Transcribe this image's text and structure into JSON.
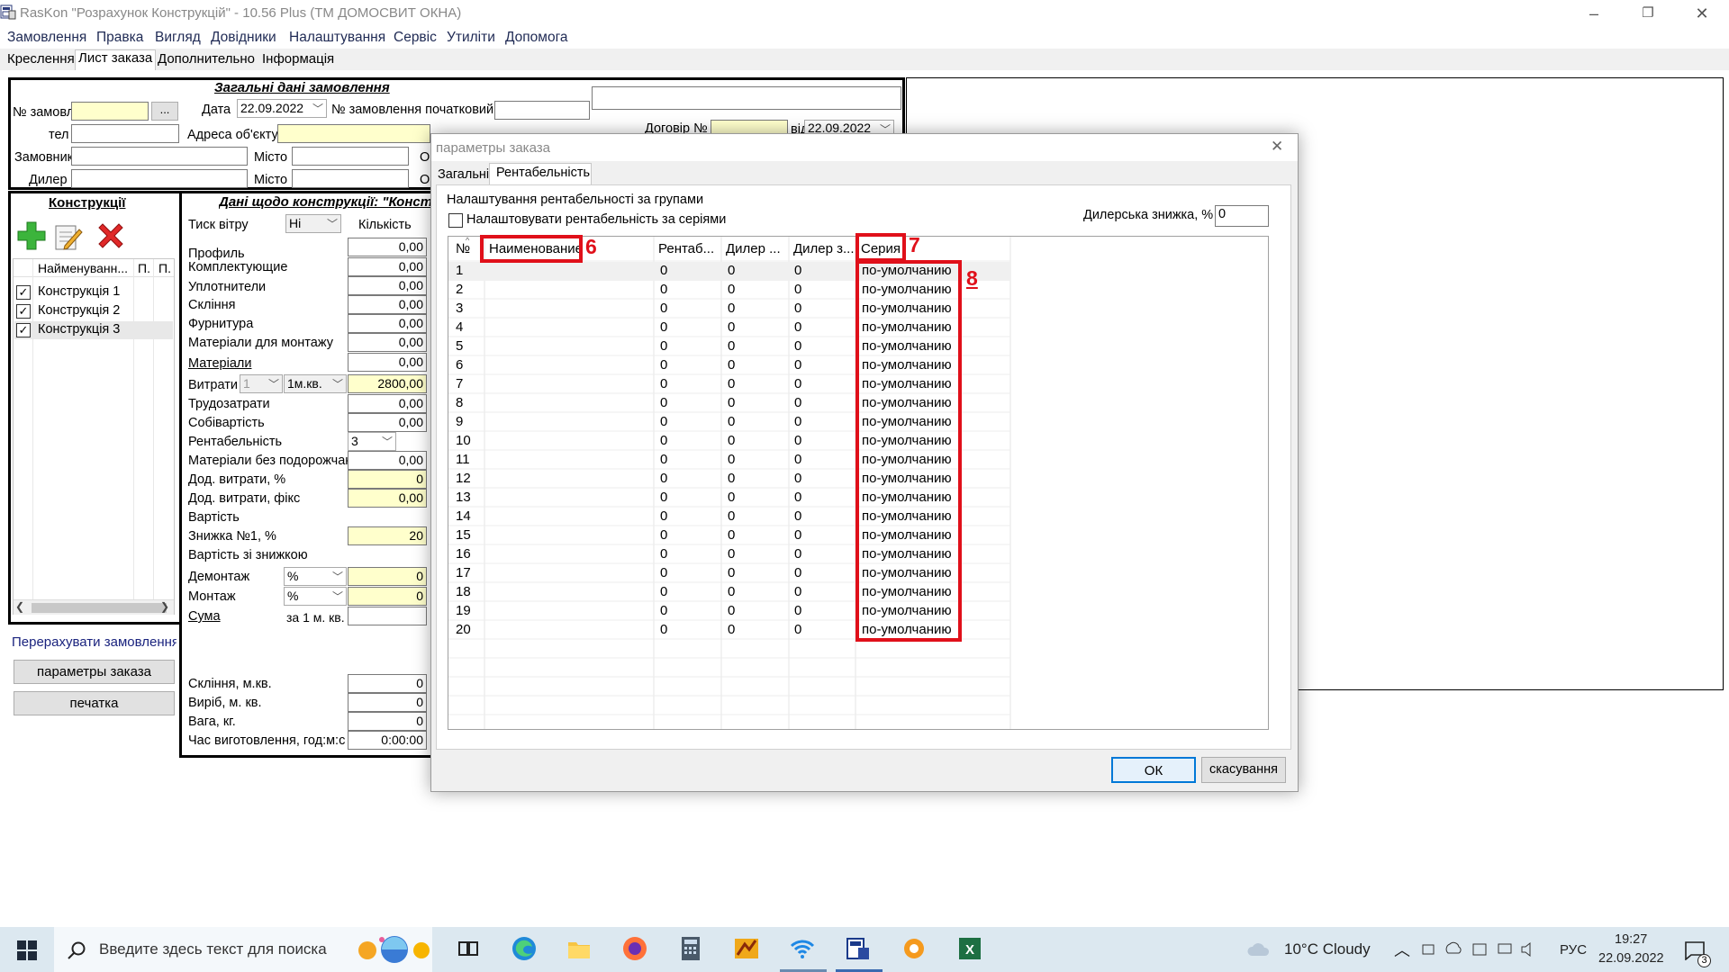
{
  "window": {
    "title": "RasKon \"Розрахунок Конструкцій\" - 10.56 Plus (ТМ ДОМОСВИТ ОКНА)",
    "minimize": "–",
    "restore": "❐",
    "close": "✕"
  },
  "menu": [
    "Замовлення",
    "Правка",
    "Вигляд",
    "Довідники",
    "Налаштування",
    "Сервіс",
    "Утиліти",
    "Допомога"
  ],
  "tabs": [
    "Креслення",
    "Лист заказа",
    "Дополнительно",
    "Інформація"
  ],
  "general": {
    "heading": "Загальні дані замовлення",
    "order_no_label": "№ замовл",
    "order_no_btn": "...",
    "date_label": "Дата",
    "date_value": "22.09.2022",
    "initial_no_label": "№ замовлення початковий",
    "phone_label": "тел",
    "address_label": "Адреса об'єкту",
    "contract_label": "Договір №",
    "contract_from_label": "від",
    "contract_date": "22.09.2022",
    "customer_label": "Замовник",
    "city_label": "Місто",
    "city2_label": "Місто",
    "dealer_label": "Дилер",
    "o_label": "О"
  },
  "constructions": {
    "heading": "Конструкції",
    "col_name": "Найменуванн...",
    "col_p1": "П.",
    "col_p2": "П.",
    "items": [
      "Конструкція 1",
      "Конструкція 2",
      "Конструкція 3"
    ]
  },
  "details": {
    "heading": "Дані щодо конструкції: \"Констру",
    "wind_label": "Тиск вітру",
    "wind_value": "Ні",
    "qty_label": "Кількість",
    "rows": [
      {
        "label": "Профиль",
        "value": "0,00"
      },
      {
        "label": "Комплектующие",
        "value": "0,00"
      },
      {
        "label": "Уплотнители",
        "value": "0,00"
      },
      {
        "label": "Склiння",
        "value": "0,00"
      },
      {
        "label": "Фурнитура",
        "value": "0,00"
      },
      {
        "label": "Матеріали для монтажу",
        "value": "0,00"
      },
      {
        "label": "Матеріали",
        "value": "0,00"
      }
    ],
    "expense_label": "Витрати",
    "expense_combo1": "1",
    "expense_combo2": "1м.кв.",
    "expense_value": "2800,00",
    "labor_label": "Трудозатрати",
    "labor_value": "0,00",
    "cost_label": "Собівартість",
    "cost_value": "0,00",
    "profit_label": "Рентабельність",
    "profit_value": "3",
    "mat_label": "Матеріали без подорожчан",
    "mat_value": "0,00",
    "addexp_pct_label": "Дод. витрати, %",
    "addexp_pct_value": "0",
    "addexp_fix_label": "Дод. витрати, фікс",
    "addexp_fix_value": "0,00",
    "price_label": "Вартість",
    "disc_label": "Знижка №1, %",
    "disc_value": "20",
    "price_disc_label": "Вартість зі знижкою",
    "dismantle_label": "Демонтаж",
    "dismantle_unit": "%",
    "dismantle_value": "0",
    "mount_label": "Монтаж",
    "mount_unit": "%",
    "mount_value": "0",
    "sum_label": "Сума",
    "per_sqm_label": "за 1 м. кв.",
    "glass_label": "Склiння, м.кв.",
    "glass_value": "0",
    "item_label": "Виріб, м. кв.",
    "item_value": "0",
    "weight_label": "Вага, кг.",
    "weight_value": "0",
    "time_label": "Час виготовлення, год:м:с",
    "time_value": "0:00:00"
  },
  "left_actions": {
    "recalc": "Перерахувати замовлення",
    "params": "параметры заказа",
    "print": "печатка"
  },
  "dialog": {
    "title": "параметры заказа",
    "close": "✕",
    "tab_general": "Загальні",
    "tab_profit": "Рентабельність",
    "group_label": "Налаштування рентабельності за групами",
    "series_checkbox": "Налаштовувати рентабельність за серіями",
    "dealer_disc_label": "Дилерська знижка, %",
    "dealer_disc_value": "0",
    "columns": [
      "№",
      "Наименование",
      "Рентаб...",
      "Дилер ...",
      "Дилер з...",
      "Серия"
    ],
    "rows": [
      [
        "1",
        "",
        "0",
        "0",
        "0",
        "по-умолчанию"
      ],
      [
        "2",
        "",
        "0",
        "0",
        "0",
        "по-умолчанию"
      ],
      [
        "3",
        "",
        "0",
        "0",
        "0",
        "по-умолчанию"
      ],
      [
        "4",
        "",
        "0",
        "0",
        "0",
        "по-умолчанию"
      ],
      [
        "5",
        "",
        "0",
        "0",
        "0",
        "по-умолчанию"
      ],
      [
        "6",
        "",
        "0",
        "0",
        "0",
        "по-умолчанию"
      ],
      [
        "7",
        "",
        "0",
        "0",
        "0",
        "по-умолчанию"
      ],
      [
        "8",
        "",
        "0",
        "0",
        "0",
        "по-умолчанию"
      ],
      [
        "9",
        "",
        "0",
        "0",
        "0",
        "по-умолчанию"
      ],
      [
        "10",
        "",
        "0",
        "0",
        "0",
        "по-умолчанию"
      ],
      [
        "11",
        "",
        "0",
        "0",
        "0",
        "по-умолчанию"
      ],
      [
        "12",
        "",
        "0",
        "0",
        "0",
        "по-умолчанию"
      ],
      [
        "13",
        "",
        "0",
        "0",
        "0",
        "по-умолчанию"
      ],
      [
        "14",
        "",
        "0",
        "0",
        "0",
        "по-умолчанию"
      ],
      [
        "15",
        "",
        "0",
        "0",
        "0",
        "по-умолчанию"
      ],
      [
        "16",
        "",
        "0",
        "0",
        "0",
        "по-умолчанию"
      ],
      [
        "17",
        "",
        "0",
        "0",
        "0",
        "по-умолчанию"
      ],
      [
        "18",
        "",
        "0",
        "0",
        "0",
        "по-умолчанию"
      ],
      [
        "19",
        "",
        "0",
        "0",
        "0",
        "по-умолчанию"
      ],
      [
        "20",
        "",
        "0",
        "0",
        "0",
        "по-умолчанию"
      ]
    ],
    "ok": "ОК",
    "cancel": "скасування",
    "annotations": {
      "a6": "6",
      "a7": "7",
      "a8": "8"
    },
    "annotation_color": "#e0101a"
  },
  "taskbar": {
    "search_placeholder": "Введите здесь текст для поиска",
    "weather": "10°C  Cloudy",
    "lang": "РУС",
    "time": "19:27",
    "date": "22.09.2022",
    "notif_count": "3"
  }
}
